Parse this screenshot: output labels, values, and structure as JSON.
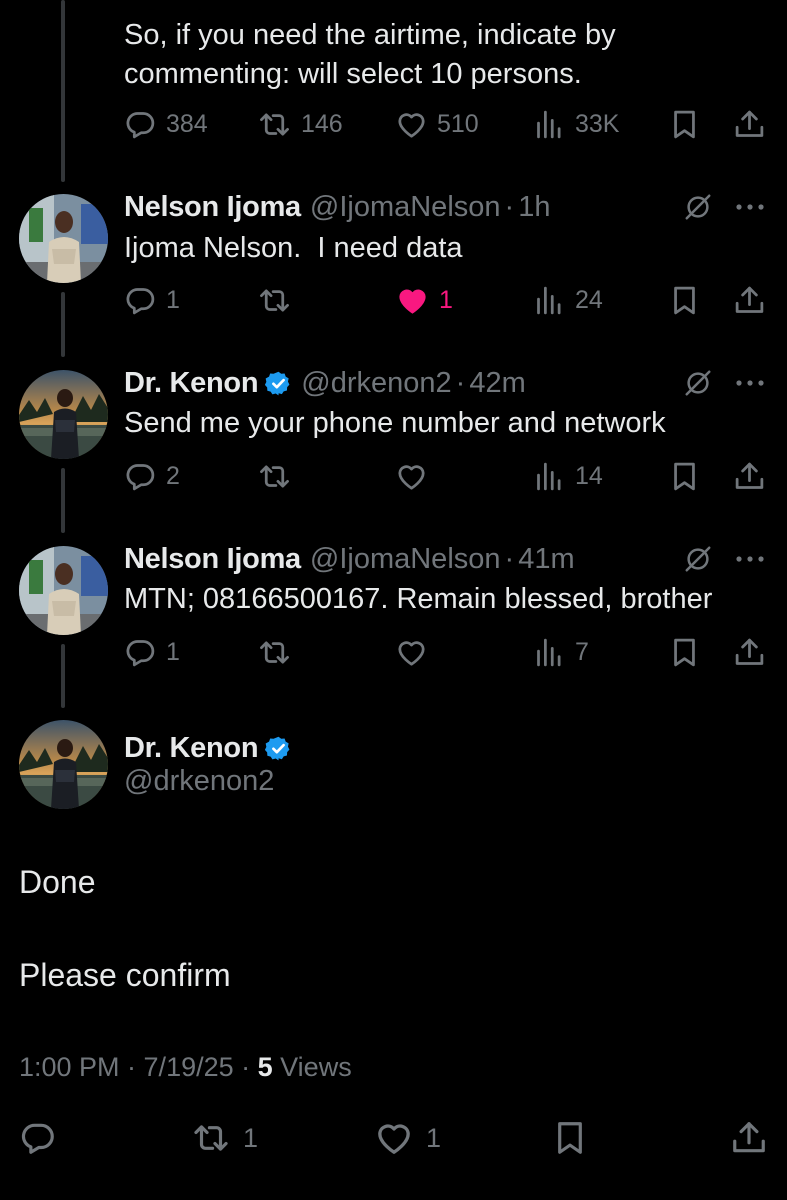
{
  "colors": {
    "background": "#000000",
    "text": "#e7e9ea",
    "muted": "#71767b",
    "like": "#f91880",
    "verified": "#1d9bf0",
    "thread_line": "#333639"
  },
  "parent_tweet": {
    "text_lines": [
      "So, if you need the airtime, indicate by",
      "commenting: will select 10 persons."
    ],
    "replies": "384",
    "reposts": "146",
    "likes": "510",
    "views": "33K"
  },
  "replies": [
    {
      "name": "Nelson Ijoma",
      "handle": "@IjomaNelson",
      "separator": "·",
      "time": "1h",
      "text": "Ijoma Nelson.  I need data",
      "replies": "1",
      "reposts": "",
      "likes": "1",
      "liked": true,
      "views": "24",
      "verified": false
    },
    {
      "name": "Dr. Kenon",
      "handle": "@drkenon2",
      "separator": "·",
      "time": "42m",
      "text": "Send me your phone number and network",
      "replies": "2",
      "reposts": "",
      "likes": "",
      "liked": false,
      "views": "14",
      "verified": true
    },
    {
      "name": "Nelson Ijoma",
      "handle": "@IjomaNelson",
      "separator": "·",
      "time": "41m",
      "text": "MTN; 08166500167. Remain blessed, brother",
      "replies": "1",
      "reposts": "",
      "likes": "",
      "liked": false,
      "views": "7",
      "verified": false
    }
  ],
  "focal_tweet": {
    "name": "Dr. Kenon",
    "handle": "@drkenon2",
    "verified": true,
    "paragraphs": [
      "Done",
      "Please confirm"
    ],
    "timestamp": "1:00 PM · 7/19/25 · ",
    "views_count": "5",
    "views_label": " Views",
    "replies": "",
    "reposts": "1",
    "likes": "1"
  },
  "icons": [
    "reply-icon",
    "repost-icon",
    "like-icon",
    "views-icon",
    "bookmark-icon",
    "share-icon",
    "grok-icon",
    "more-icon",
    "verified-badge-icon"
  ]
}
